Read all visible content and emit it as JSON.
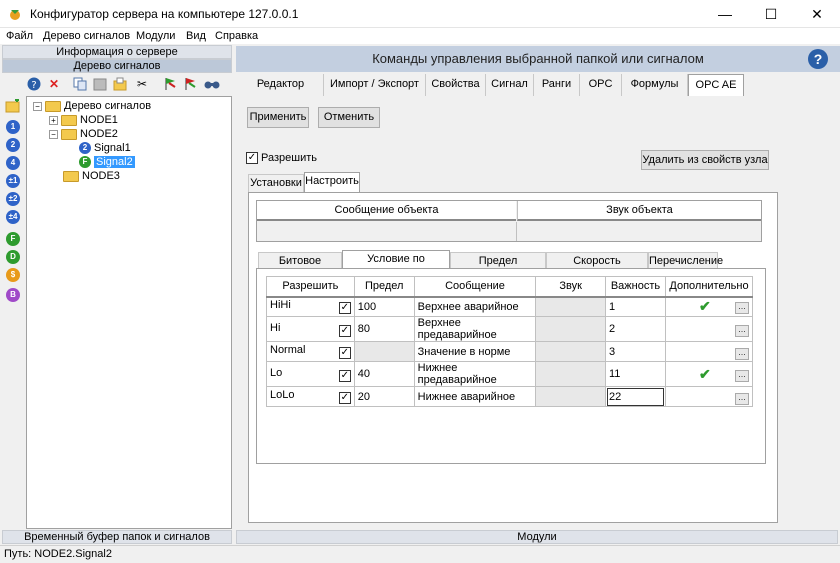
{
  "window": {
    "title": "Конфигуратор сервера на компьютере 127.0.0.1",
    "minimize": "—",
    "maximize": "☐",
    "close": "✕"
  },
  "menu": [
    "Файл",
    "Дерево сигналов",
    "Модули",
    "Вид",
    "Справка"
  ],
  "left": {
    "head_info": "Информация о сервере",
    "head_tree": "Дерево сигналов",
    "head_buffer": "Временный буфер папок и сигналов",
    "tree": {
      "root": "Дерево сигналов",
      "node1": "NODE1",
      "node2": "NODE2",
      "signal1": "Signal1",
      "signal2": "Signal2",
      "node3": "NODE3"
    },
    "side_icons": [
      "1",
      "2",
      "4",
      "±1",
      "±2",
      "±4",
      "F",
      "D",
      "$",
      "B"
    ]
  },
  "right": {
    "header": "Команды управления выбранной папкой или сигналом",
    "help": "?",
    "tabs": [
      "Редактор адреса",
      "Импорт / Экспорт",
      "Свойства",
      "Сигнал",
      "Ранги",
      "OPC",
      "Формулы",
      "OPC AE"
    ],
    "apply": "Применить",
    "cancel": "Отменить",
    "enable_label": "Разрешить",
    "delete_label": "Удалить из свойств узла",
    "subtabs": [
      "Установки",
      "Настроить"
    ],
    "obj_message_header": "Сообщение объекта",
    "obj_sound_header": "Звук объекта",
    "cond_tabs": [
      "Битовое условие",
      "Условие по пределам",
      "Предел отклонения",
      "Скорость изменения",
      "Перечисление"
    ],
    "grid_headers": [
      "Разрешить",
      "Предел",
      "Сообщение",
      "Звук",
      "Важность",
      "Дополнительно"
    ],
    "rows": [
      {
        "name": "HiHi",
        "limit": "100",
        "message": "Верхнее аварийное",
        "sound": "",
        "priority": "1",
        "extra": true
      },
      {
        "name": "Hi",
        "limit": "80",
        "message": "Верхнее предаварийное",
        "sound": "",
        "priority": "2",
        "extra": false
      },
      {
        "name": "Normal",
        "limit": "",
        "message": "Значение в норме",
        "sound": "",
        "priority": "3",
        "extra": false
      },
      {
        "name": "Lo",
        "limit": "40",
        "message": "Нижнее предаварийное",
        "sound": "",
        "priority": "11",
        "extra": true
      },
      {
        "name": "LoLo",
        "limit": "20",
        "message": "Нижнее аварийное",
        "sound": "",
        "priority": "22",
        "extra": false
      }
    ],
    "modules": "Модули"
  },
  "status": "Путь: NODE2.Signal2"
}
